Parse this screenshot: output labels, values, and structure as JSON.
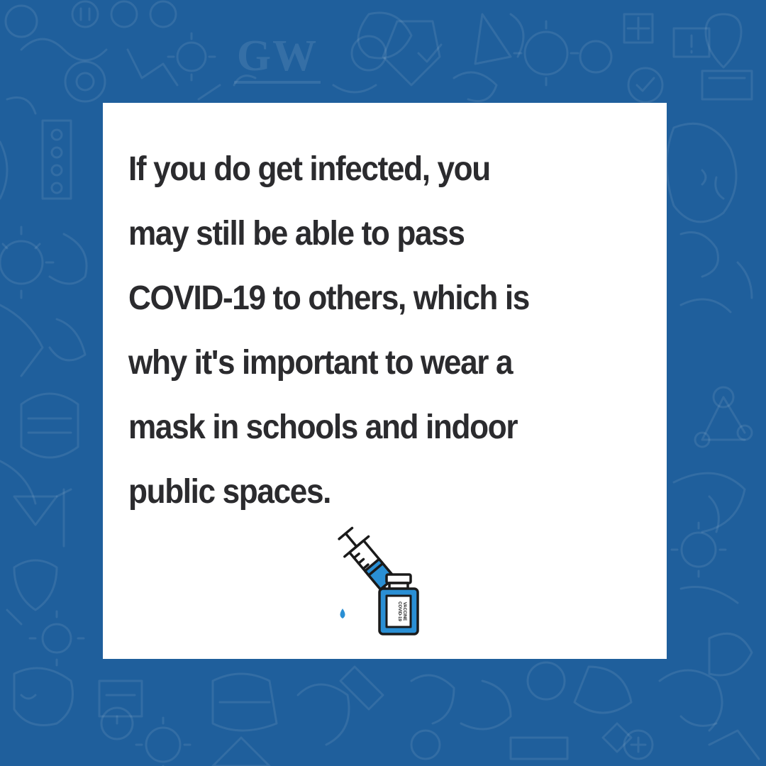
{
  "logo": {
    "text": "GW"
  },
  "message": {
    "lines": [
      "If you do get infected, you",
      "may still be able to pass",
      "COVID-19 to others, which is",
      "why it's important to wear a",
      "mask in schools and indoor",
      "public spaces."
    ]
  },
  "illustration": {
    "icon": "vaccine-syringe-icon",
    "vial_label": [
      "COVID-19",
      "VACCINE"
    ]
  },
  "colors": {
    "background": "#1f5f9c",
    "card": "#ffffff",
    "text": "#2b2b2e",
    "accent": "#2a8fd4"
  }
}
